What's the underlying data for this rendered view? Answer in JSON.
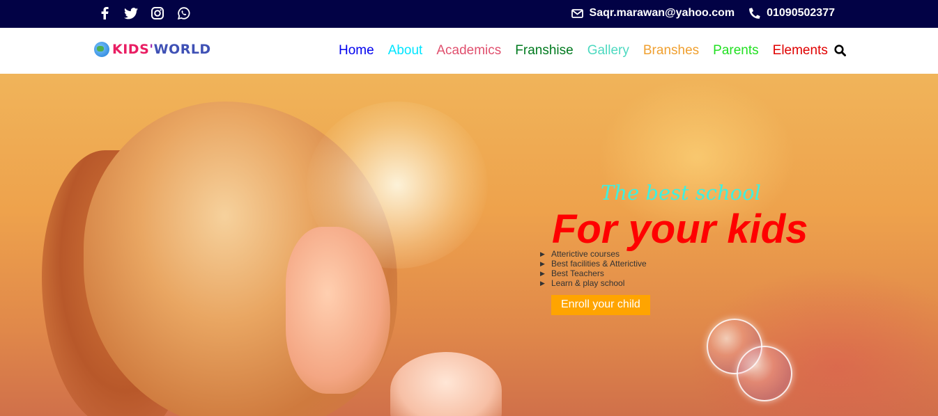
{
  "topbar": {
    "social": [
      {
        "icon": "facebook-icon"
      },
      {
        "icon": "twitter-icon"
      },
      {
        "icon": "instagram-icon"
      },
      {
        "icon": "whatsapp-icon"
      }
    ],
    "email": "Saqr.marawan@yahoo.com",
    "phone": "01090502377",
    "bg_color": "#020245"
  },
  "navbar": {
    "logo": {
      "kids": "KIDS",
      "apostrophe": "'",
      "world": "WORLD"
    },
    "menu": [
      {
        "label": "Home",
        "color": "#0000ee"
      },
      {
        "label": "About",
        "color": "#00e5ff"
      },
      {
        "label": "Academics",
        "color": "#e0506e"
      },
      {
        "label": "Franshise",
        "color": "#007a1f"
      },
      {
        "label": "Gallery",
        "color": "#4dd9c0"
      },
      {
        "label": "Branshes",
        "color": "#f0a030"
      },
      {
        "label": "Parents",
        "color": "#22e022"
      },
      {
        "label": "Elements",
        "color": "#e00000"
      }
    ],
    "search_icon": "search-icon"
  },
  "hero": {
    "tagline": "The best school",
    "headline": "For your kids",
    "features": [
      "Atterictive courses",
      "Best facilities & Atterictive",
      "Best Teachers",
      "Learn & play school"
    ],
    "enroll_label": "Enroll your child",
    "enroll_color": "#ffa400"
  }
}
